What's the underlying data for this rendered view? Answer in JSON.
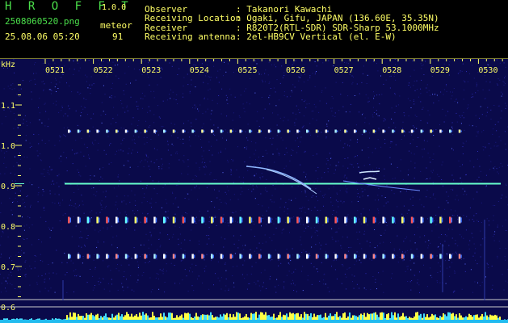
{
  "app": {
    "logo": "H R O F F T",
    "version": "1.0.0",
    "filename": "2508060520.png",
    "datetime": "25.08.06 05:20",
    "meteor_label": "meteor",
    "meteor_count": "91"
  },
  "info": {
    "observer_label": "Observer",
    "observer_value": ": Takanori Kawachi",
    "location_label": "Receiving Location",
    "location_value": ": Ogaki, Gifu, JAPAN (136.60E, 35.35N)",
    "receiver_label": "Receiver",
    "receiver_value": ": R820T2(RTL-SDR) SDR-Sharp 53.1000MHz",
    "antenna_label": "Receiving antenna",
    "antenna_value": ": 2el-HB9CV Vertical (el. E-W)"
  },
  "chart_data": {
    "type": "heatmap",
    "ylabel": "kHz",
    "x_ticks": [
      "0521",
      "0522",
      "0523",
      "0524",
      "0525",
      "0526",
      "0527",
      "0528",
      "0529",
      "0530"
    ],
    "y_ticks": [
      "1.1",
      "1.0",
      "0.9",
      "0.8",
      "0.7",
      "0.6"
    ],
    "ylim": [
      0.59,
      1.17
    ],
    "carrier_khz": 0.905,
    "pulse_rows_khz": [
      1.035,
      0.815,
      0.725
    ],
    "colors": {
      "background": "#0a0a4a",
      "carrier": "#66ffcc",
      "axis": "#ffff66"
    }
  }
}
